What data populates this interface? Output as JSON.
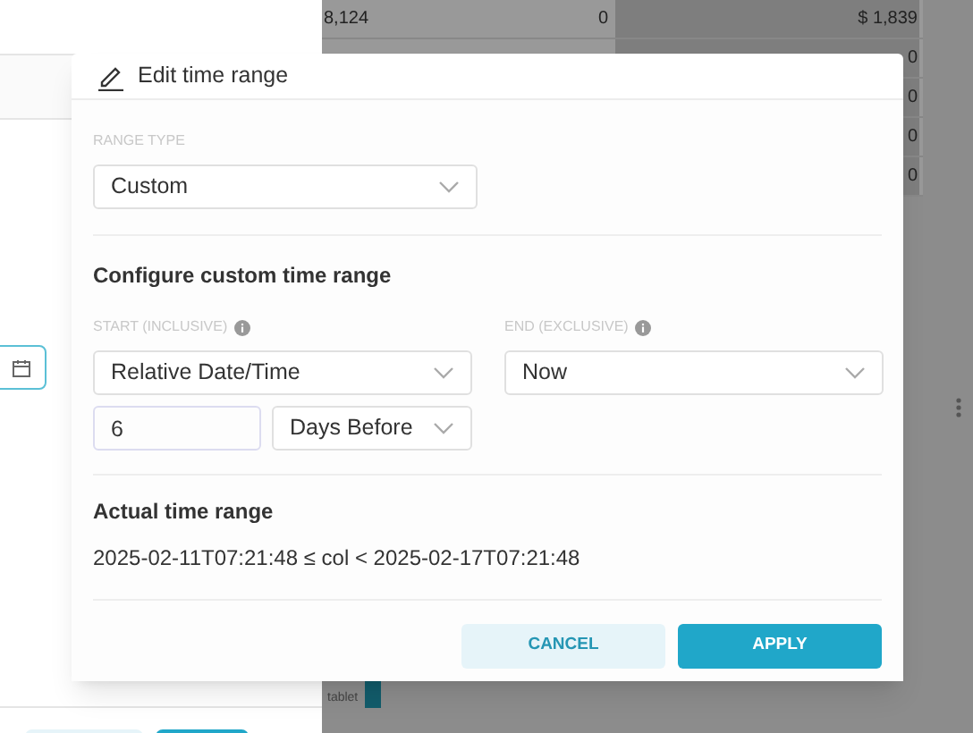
{
  "background": {
    "table_rows": [
      [
        "8,124",
        "0",
        "$ 1,839"
      ],
      [
        "",
        "",
        "0"
      ],
      [
        "",
        "",
        "0"
      ],
      [
        "",
        "",
        "0"
      ],
      [
        "",
        "",
        "0"
      ]
    ],
    "chart_label": "tablet"
  },
  "popover": {
    "title": "Edit time range",
    "range_type": {
      "label": "RANGE TYPE",
      "value": "Custom"
    },
    "section_title": "Configure custom time range",
    "start": {
      "label": "START (INCLUSIVE)",
      "value": "Relative Date/Time",
      "amount": "6",
      "unit": "Days Before"
    },
    "end": {
      "label": "END (EXCLUSIVE)",
      "value": "Now"
    },
    "actual": {
      "title": "Actual time range",
      "text": "2025-02-11T07:21:48 ≤ col < 2025-02-17T07:21:48"
    },
    "buttons": [
      {
        "label": "CANCEL",
        "kind": "secondary"
      },
      {
        "label": "APPLY",
        "kind": "primary"
      }
    ]
  }
}
